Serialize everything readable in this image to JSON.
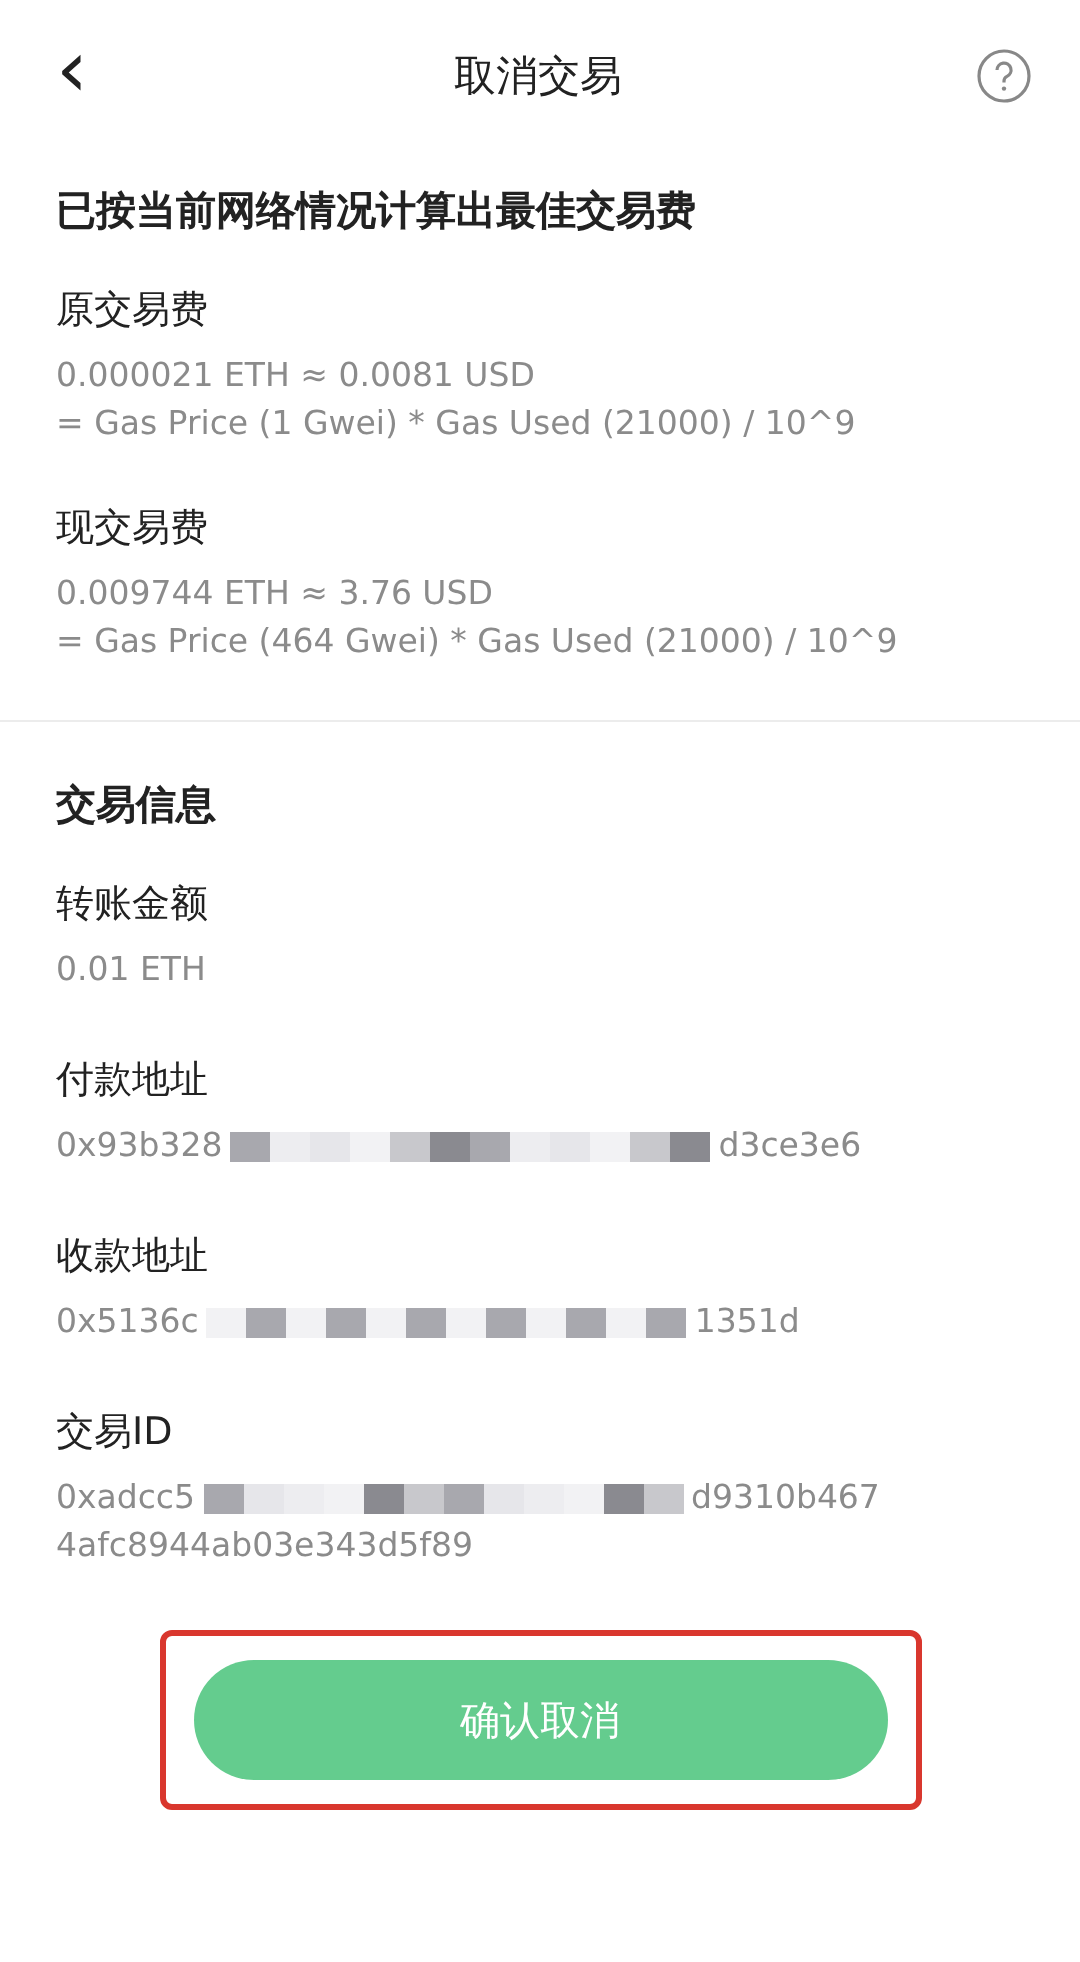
{
  "header": {
    "back": "‹",
    "title": "取消交易"
  },
  "fee_section": {
    "heading": "已按当前网络情况计算出最佳交易费",
    "items": [
      {
        "label": "原交易费",
        "lines": [
          "0.000021 ETH ≈ 0.0081 USD",
          "= Gas Price (1 Gwei) * Gas Used (21000) / 10^9"
        ]
      },
      {
        "label": "现交易费",
        "lines": [
          "0.009744 ETH ≈ 3.76 USD",
          "= Gas Price (464 Gwei) * Gas Used (21000) / 10^9"
        ]
      }
    ]
  },
  "info_section": {
    "heading": "交易信息",
    "items": [
      {
        "label": "转账金额",
        "value_start": "0.01 ETH",
        "redacted": false
      },
      {
        "label": "付款地址",
        "value_start": "0x93b328",
        "redacted": true,
        "value_end": "d3ce3e6"
      },
      {
        "label": "收款地址",
        "value_start": "0x5136c",
        "redacted": true,
        "value_end": "1351d"
      },
      {
        "label": "交易ID",
        "value_start": "0xadcc5",
        "redacted": true,
        "value_end": "d9310b467",
        "value_more": "4afc8944ab03e343d5f89"
      }
    ]
  },
  "confirm_button": {
    "label": "确认取消",
    "highlighted": true
  }
}
